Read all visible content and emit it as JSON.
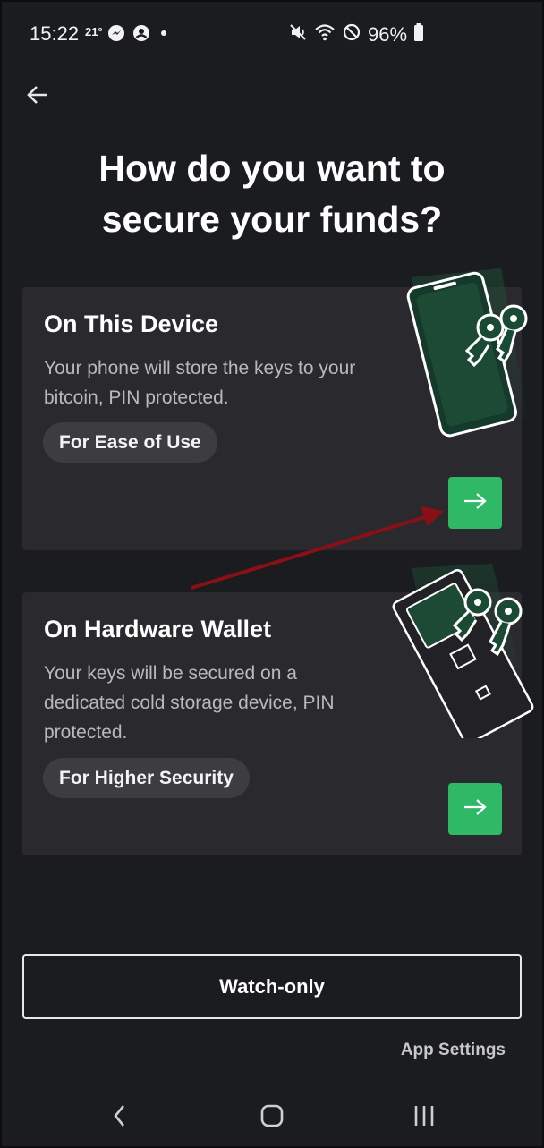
{
  "status_bar": {
    "time": "15:22",
    "temperature": "21°",
    "battery": "96%",
    "icons_left": [
      "messenger-icon",
      "account-circle-icon",
      "dot-icon"
    ],
    "icons_right": [
      "mute-vibrate-icon",
      "wifi-icon",
      "do-not-disturb-icon",
      "battery-icon"
    ]
  },
  "header": {
    "back_icon": "arrow-left-icon",
    "title": "How do you want to secure your funds?"
  },
  "options": [
    {
      "title": "On This Device",
      "description": "Your phone will store the keys to your bitcoin, PIN protected.",
      "tag": "For Ease of Use",
      "action_icon": "arrow-right-icon",
      "illustration": "phone-with-keys-icon"
    },
    {
      "title": "On Hardware Wallet",
      "description": "Your keys will be secured on a dedicated cold storage device, PIN protected.",
      "tag": "For Higher Security",
      "action_icon": "arrow-right-icon",
      "illustration": "hardware-wallet-with-keys-icon"
    }
  ],
  "footer": {
    "watch_only_label": "Watch-only",
    "app_settings_label": "App Settings"
  },
  "nav_bar": {
    "icons": [
      "nav-back-icon",
      "nav-home-icon",
      "nav-recents-icon"
    ]
  },
  "colors": {
    "background": "#1b1c20",
    "card": "#2a2a2e",
    "accent_green": "#2fb865",
    "pill": "#3d3d41",
    "annotation_arrow": "#8b0f14"
  }
}
